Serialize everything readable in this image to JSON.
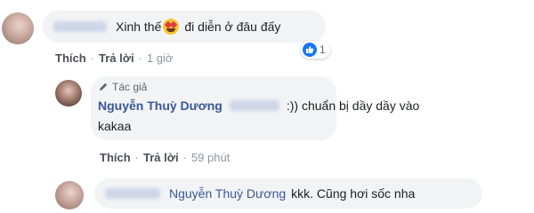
{
  "comment1": {
    "text_prefix": "Xinh thế",
    "emoji": "heart-eyes-emoji",
    "text_suffix": "đi diễn ở đâu đấy",
    "reaction_count": "1",
    "actions": {
      "like": "Thích",
      "reply": "Trả lời",
      "time": "1 giờ"
    }
  },
  "reply1": {
    "badge": "Tác giả",
    "author": "Nguyễn Thuỳ Dương",
    "text_line1": ":)) chuẩn bị dầy dầy vào",
    "text_line2": "kakaa",
    "actions": {
      "like": "Thích",
      "reply": "Trả lời",
      "time": "59 phút"
    }
  },
  "reply2": {
    "mention": "Nguyễn Thuỳ Dương",
    "text": "kkk. Cũng hơi sốc nha"
  },
  "colors": {
    "bubble": "#f2f3f5",
    "author": "#385898",
    "link": "#4b4f56",
    "time": "#90949c",
    "like": "#1877f2"
  }
}
